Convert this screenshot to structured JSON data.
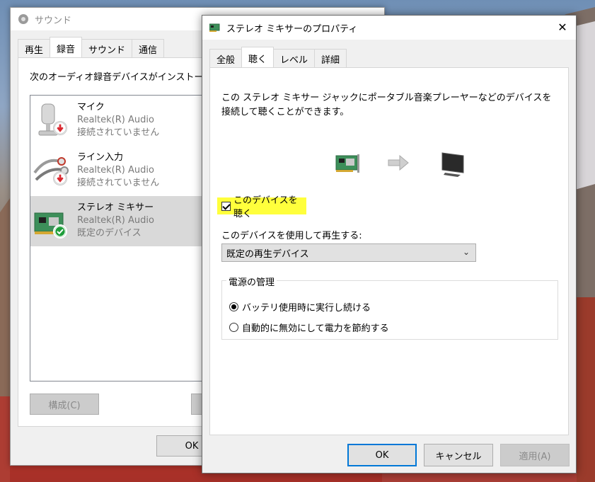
{
  "sound_window": {
    "title": "サウンド",
    "tabs": [
      {
        "label": "再生"
      },
      {
        "label": "録音"
      },
      {
        "label": "サウンド"
      },
      {
        "label": "通信"
      }
    ],
    "description": "次のオーディオ録音デバイスがインストールされています:",
    "devices": [
      {
        "name": "マイク",
        "driver": "Realtek(R) Audio",
        "status": "接続されていません"
      },
      {
        "name": "ライン入力",
        "driver": "Realtek(R) Audio",
        "status": "接続されていません"
      },
      {
        "name": "ステレオ ミキサー",
        "driver": "Realtek(R) Audio",
        "status": "既定のデバイス"
      }
    ],
    "configure_label": "構成(C)",
    "ok_label": "OK"
  },
  "properties_dialog": {
    "title": "ステレオ ミキサーのプロパティ",
    "close_glyph": "✕",
    "tabs": [
      {
        "label": "全般"
      },
      {
        "label": "聴く"
      },
      {
        "label": "レベル"
      },
      {
        "label": "詳細"
      }
    ],
    "description": "この ステレオ ミキサー ジャックにポータブル音楽プレーヤーなどのデバイスを接続して聴くことができます。",
    "listen_checkbox_label": "このデバイスを聴く",
    "listen_checked": true,
    "playback_label": "このデバイスを使用して再生する:",
    "playback_selected": "既定の再生デバイス",
    "power_group_label": "電源の管理",
    "power_options": [
      {
        "label": "バッテリ使用時に実行し続ける",
        "checked": true
      },
      {
        "label": "自動的に無効にして電力を節約する",
        "checked": false
      }
    ],
    "ok_label": "OK",
    "cancel_label": "キャンセル",
    "apply_label": "適用(A)"
  },
  "colors": {
    "highlight": "#ffff3c",
    "focus_border": "#0078d7",
    "default_badge": "#1e9e3a",
    "error_badge": "#d9262e"
  }
}
